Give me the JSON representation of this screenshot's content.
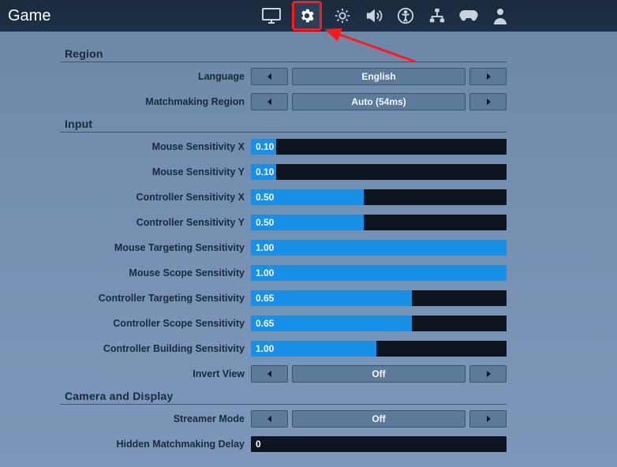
{
  "topbar": {
    "title": "Game"
  },
  "tabs": [
    {
      "name": "monitor-icon"
    },
    {
      "name": "gear-icon",
      "active": true
    },
    {
      "name": "brightness-icon"
    },
    {
      "name": "volume-icon"
    },
    {
      "name": "accessibility-icon"
    },
    {
      "name": "network-icon"
    },
    {
      "name": "controller-icon"
    },
    {
      "name": "user-icon"
    }
  ],
  "sections": {
    "region": {
      "header": "Region",
      "language": {
        "label": "Language",
        "value": "English"
      },
      "matchmaking": {
        "label": "Matchmaking Region",
        "value": "Auto (54ms)"
      }
    },
    "input": {
      "header": "Input",
      "mouse_x": {
        "label": "Mouse Sensitivity X",
        "value": "0.10",
        "fill": 0.1
      },
      "mouse_y": {
        "label": "Mouse Sensitivity Y",
        "value": "0.10",
        "fill": 0.1
      },
      "ctrl_x": {
        "label": "Controller Sensitivity X",
        "value": "0.50",
        "fill": 0.44
      },
      "ctrl_y": {
        "label": "Controller Sensitivity Y",
        "value": "0.50",
        "fill": 0.44
      },
      "mouse_target": {
        "label": "Mouse Targeting Sensitivity",
        "value": "1.00",
        "fill": 1.0
      },
      "mouse_scope": {
        "label": "Mouse Scope Sensitivity",
        "value": "1.00",
        "fill": 1.0
      },
      "ctrl_target": {
        "label": "Controller Targeting Sensitivity",
        "value": "0.65",
        "fill": 0.63
      },
      "ctrl_scope": {
        "label": "Controller Scope Sensitivity",
        "value": "0.65",
        "fill": 0.63
      },
      "ctrl_build": {
        "label": "Controller Building Sensitivity",
        "value": "1.00",
        "fill": 0.49
      },
      "invert": {
        "label": "Invert View",
        "value": "Off"
      }
    },
    "camera": {
      "header": "Camera and Display",
      "streamer": {
        "label": "Streamer Mode",
        "value": "Off"
      },
      "hmd": {
        "label": "Hidden Matchmaking Delay",
        "value": "0"
      }
    }
  }
}
